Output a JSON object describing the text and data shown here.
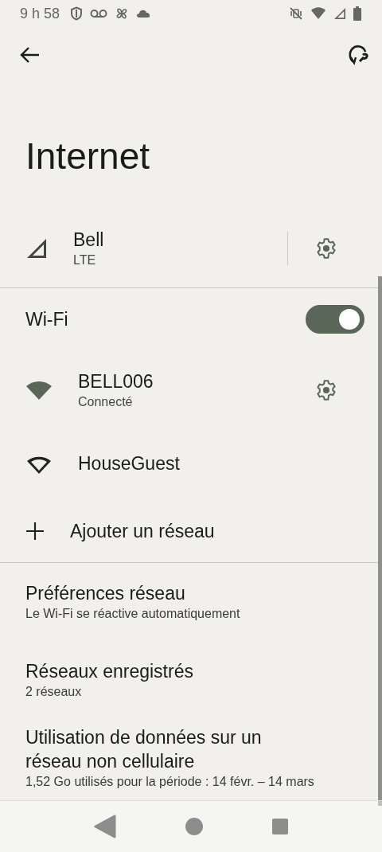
{
  "status_bar": {
    "time": "9 h 58"
  },
  "title": "Internet",
  "mobile": {
    "name": "Bell",
    "subtitle": "LTE"
  },
  "wifi": {
    "label": "Wi-Fi",
    "on": true
  },
  "networks": [
    {
      "name": "BELL006",
      "status": "Connecté",
      "connected": true
    },
    {
      "name": "HouseGuest",
      "connected": false
    }
  ],
  "add_network": "Ajouter un réseau",
  "items": [
    {
      "title": "Préférences réseau",
      "subtitle": "Le Wi-Fi se réactive automatiquement"
    },
    {
      "title": "Réseaux enregistrés",
      "subtitle": "2 réseaux"
    },
    {
      "title": "Utilisation de données sur un réseau non cellulaire",
      "subtitle": "1,52 Go utilisés pour la période : 14 févr. – 14 mars"
    }
  ]
}
